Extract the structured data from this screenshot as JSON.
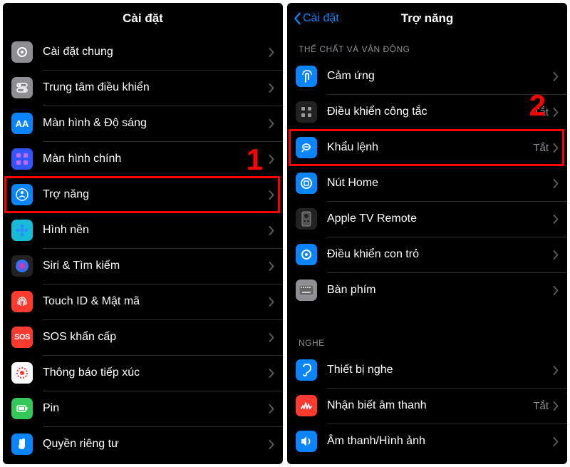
{
  "left": {
    "title": "Cài đặt",
    "callout_number": "1",
    "rows": [
      {
        "key": "general",
        "label": "Cài đặt chung",
        "icon": "gear",
        "bg": "#8e8e93"
      },
      {
        "key": "controlctr",
        "label": "Trung tâm điều khiển",
        "icon": "switches",
        "bg": "#8e8e93"
      },
      {
        "key": "display",
        "label": "Màn hình & Độ sáng",
        "icon": "aa",
        "bg": "#0a84ff"
      },
      {
        "key": "home",
        "label": "Màn hình chính",
        "icon": "grid",
        "bg": "#3355ff"
      },
      {
        "key": "accessibility",
        "label": "Trợ năng",
        "icon": "person",
        "bg": "#0a84ff",
        "highlighted": true
      },
      {
        "key": "wallpaper",
        "label": "Hình nền",
        "icon": "flower",
        "bg": "#17bbd6"
      },
      {
        "key": "siri",
        "label": "Siri & Tìm kiếm",
        "icon": "siri",
        "bg": "#222"
      },
      {
        "key": "touchid",
        "label": "Touch ID & Mật mã",
        "icon": "finger",
        "bg": "#ff3b30"
      },
      {
        "key": "sos",
        "label": "SOS khẩn cấp",
        "icon": "sos",
        "bg": "#ff3b30"
      },
      {
        "key": "exposure",
        "label": "Thông báo tiếp xúc",
        "icon": "exposure",
        "bg": "#fff"
      },
      {
        "key": "battery",
        "label": "Pin",
        "icon": "battery",
        "bg": "#34c759"
      },
      {
        "key": "privacy",
        "label": "Quyền riêng tư",
        "icon": "hand",
        "bg": "#0a84ff"
      }
    ]
  },
  "right": {
    "title": "Trợ năng",
    "back_label": "Cài đặt",
    "callout_number": "2",
    "sections": [
      {
        "header": "THỂ CHẤT VÀ VẬN ĐỘNG",
        "rows": [
          {
            "key": "touch",
            "label": "Cảm ứng",
            "icon": "touch",
            "bg": "#0a84ff"
          },
          {
            "key": "switchctl",
            "label": "Điều khiển công tắc",
            "icon": "switchgrid",
            "bg": "#222",
            "value": "Tắt"
          },
          {
            "key": "voicectl",
            "label": "Khẩu lệnh",
            "icon": "voice",
            "bg": "#0a84ff",
            "value": "Tắt",
            "highlighted": true
          },
          {
            "key": "homebtn",
            "label": "Nút Home",
            "icon": "homebtn",
            "bg": "#0a84ff"
          },
          {
            "key": "appletv",
            "label": "Apple TV Remote",
            "icon": "remote",
            "bg": "#222"
          },
          {
            "key": "pointer",
            "label": "Điều khiển con trỏ",
            "icon": "pointer",
            "bg": "#0a84ff"
          },
          {
            "key": "keyboard",
            "label": "Bàn phím",
            "icon": "keyboard",
            "bg": "#8e8e93"
          }
        ]
      },
      {
        "header": "NGHE",
        "rows": [
          {
            "key": "hearing",
            "label": "Thiết bị nghe",
            "icon": "ear",
            "bg": "#0a84ff"
          },
          {
            "key": "soundrec",
            "label": "Nhận biết âm thanh",
            "icon": "soundrec",
            "bg": "#ff3b30",
            "value": "Tắt"
          },
          {
            "key": "av",
            "label": "Âm thanh/Hình ảnh",
            "icon": "speaker",
            "bg": "#0a84ff"
          }
        ]
      }
    ]
  },
  "colors": {
    "chevron": "#5a5a5e",
    "back": "#0a84ff",
    "highlight": "#ff0000"
  }
}
